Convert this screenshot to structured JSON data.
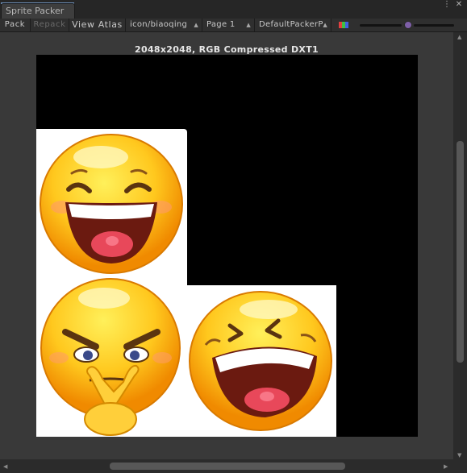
{
  "window": {
    "tab_title": "Sprite Packer",
    "controls": {
      "menu": "⋮",
      "close": "✕"
    }
  },
  "toolbar": {
    "pack_label": "Pack",
    "repack_label": "Repack",
    "view_atlas_label": "View Atlas",
    "atlas_select": "icon/biaoqing",
    "page_select": "Page 1",
    "policy_select": "DefaultPackerP",
    "color_channel_icon": "rgb-channels-icon",
    "accent_color": "#7e5fa8"
  },
  "atlas": {
    "info": "2048x2048, RGB Compressed DXT1",
    "sprites": [
      {
        "name": "laughing-face",
        "icon": "laughing-emoji-icon"
      },
      {
        "name": "smirk-hand-face",
        "icon": "smirk-emoji-icon"
      },
      {
        "name": "rofl-face",
        "icon": "rofl-emoji-icon"
      }
    ]
  },
  "scroll": {
    "up": "▲",
    "down": "▼",
    "left": "◀",
    "right": "▶"
  }
}
